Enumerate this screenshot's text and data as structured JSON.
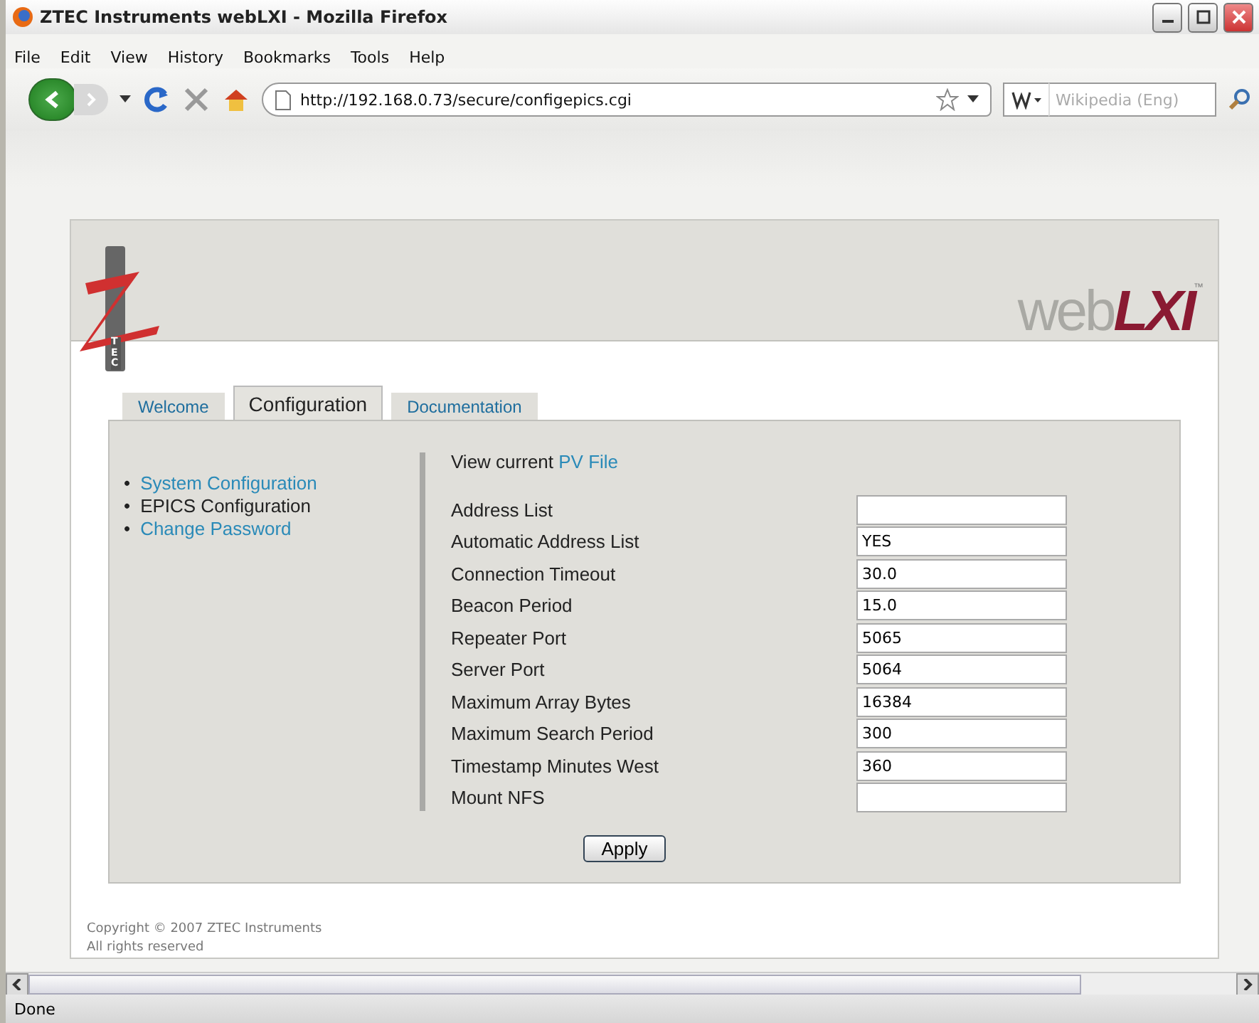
{
  "window": {
    "title": "ZTEC Instruments webLXI - Mozilla Firefox"
  },
  "menu": [
    {
      "label": "File"
    },
    {
      "label": "Edit"
    },
    {
      "label": "View"
    },
    {
      "label": "History"
    },
    {
      "label": "Bookmarks"
    },
    {
      "label": "Tools"
    },
    {
      "label": "Help"
    }
  ],
  "address_bar": {
    "value": "http://192.168.0.73/secure/configepics.cgi"
  },
  "search": {
    "placeholder": "Wikipedia (Eng)"
  },
  "logo": {
    "caption": "TEC",
    "brand_light": "web",
    "brand_bold": "LXI",
    "trademark": "™"
  },
  "tabs": [
    {
      "label": "Welcome",
      "selected": false
    },
    {
      "label": "Configuration",
      "selected": true
    },
    {
      "label": "Documentation",
      "selected": false
    }
  ],
  "sidebar": {
    "items": [
      {
        "marker": "•",
        "label": "System Configuration",
        "selected": false
      },
      {
        "marker": "•",
        "label": "EPICS Configuration",
        "selected": true
      },
      {
        "marker": "•",
        "label": "Change Password",
        "selected": false
      }
    ]
  },
  "intro": {
    "text": "View current",
    "link": "PV File"
  },
  "fields": [
    {
      "label": "Address List"
    },
    {
      "label": "Automatic Address List",
      "value": "YES"
    },
    {
      "label": "Connection Timeout",
      "value": "30.0"
    },
    {
      "label": "Beacon Period",
      "value": "15.0"
    },
    {
      "label": "Repeater Port",
      "value": "5065"
    },
    {
      "label": "Server Port",
      "value": "5064"
    },
    {
      "label": "Maximum Array Bytes",
      "value": "16384"
    },
    {
      "label": "Maximum Search Period",
      "value": "300"
    },
    {
      "label": "Timestamp Minutes West",
      "value": "360"
    },
    {
      "label": "Mount NFS"
    }
  ],
  "apply_button": {
    "label": "Apply"
  },
  "footer": [
    "Copyright © 2007 ZTEC Instruments",
    "All rights reserved"
  ],
  "status_bar": {
    "text": "Done"
  }
}
